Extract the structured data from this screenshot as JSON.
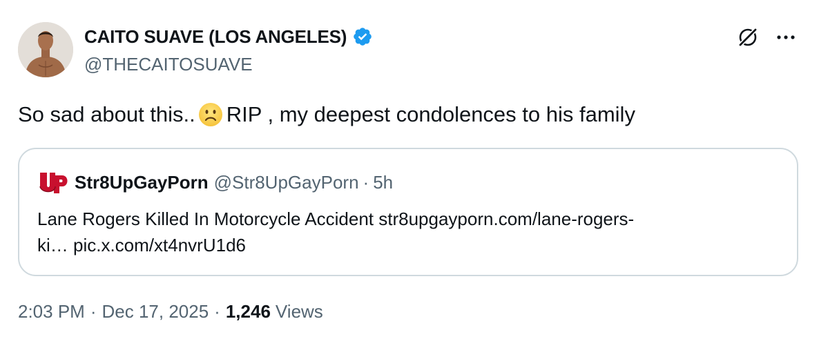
{
  "author": {
    "display_name": "CAITO SUAVE (LOS ANGELES)",
    "handle": "@THECAITOSUAVE",
    "verified": true,
    "avatar_icon": "avatar-photo"
  },
  "actions": {
    "grok_icon": "grok-icon",
    "more_icon": "more-icon"
  },
  "tweet": {
    "text_before": "So sad about this..",
    "emoji": "slightly-frowning-face",
    "text_after": "RIP , my deepest condolences to his family"
  },
  "quote": {
    "logo_icon": "str8upgayporn-logo",
    "name": "Str8UpGayPorn",
    "handle": "@Str8UpGayPorn",
    "separator": "·",
    "time": "5h",
    "line1": "Lane Rogers Killed In Motorcycle Accident str8upgayporn.com/lane-rogers-",
    "line2": "ki… pic.x.com/xt4nvrU1d6"
  },
  "meta": {
    "time": "2:03 PM",
    "separator": "·",
    "date": "Dec 17, 2025",
    "views_count": "1,246",
    "views_label": "Views"
  },
  "colors": {
    "text_primary": "#0f1419",
    "text_secondary": "#536471",
    "border": "#cfd9de",
    "verified_blue": "#1d9bf0",
    "logo_red": "#c8102e"
  }
}
